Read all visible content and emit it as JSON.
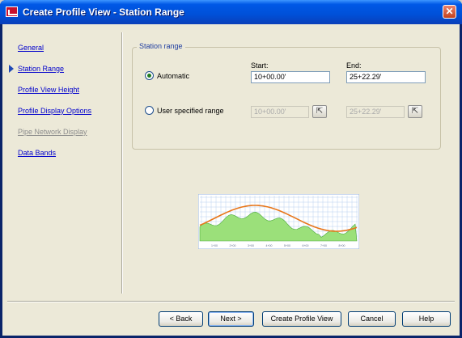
{
  "window": {
    "title": "Create Profile View - Station Range"
  },
  "nav": {
    "items": [
      {
        "label": "General"
      },
      {
        "label": "Station Range"
      },
      {
        "label": "Profile View Height"
      },
      {
        "label": "Profile Display Options"
      },
      {
        "label": "Pipe Network Display"
      },
      {
        "label": "Data Bands"
      }
    ]
  },
  "station_range": {
    "legend": "Station range",
    "start_label": "Start:",
    "end_label": "End:",
    "automatic": {
      "label": "Automatic",
      "start": "10+00.00'",
      "end": "25+22.29'",
      "selected": true
    },
    "user_specified": {
      "label": "User specified range",
      "start": "10+00.00'",
      "end": "25+22.29'",
      "selected": false
    }
  },
  "preview": {
    "tick_labels": [
      "1+00",
      "2+00",
      "3+00",
      "4+00",
      "5+00",
      "6+00",
      "7+00",
      "8+00"
    ],
    "ground_color": "#9be07a",
    "profile_color": "#e8761a",
    "grid_color": "#b8d0f0"
  },
  "buttons": {
    "back": "< Back",
    "next": "Next >",
    "create": "Create Profile View",
    "cancel": "Cancel",
    "help": "Help"
  }
}
